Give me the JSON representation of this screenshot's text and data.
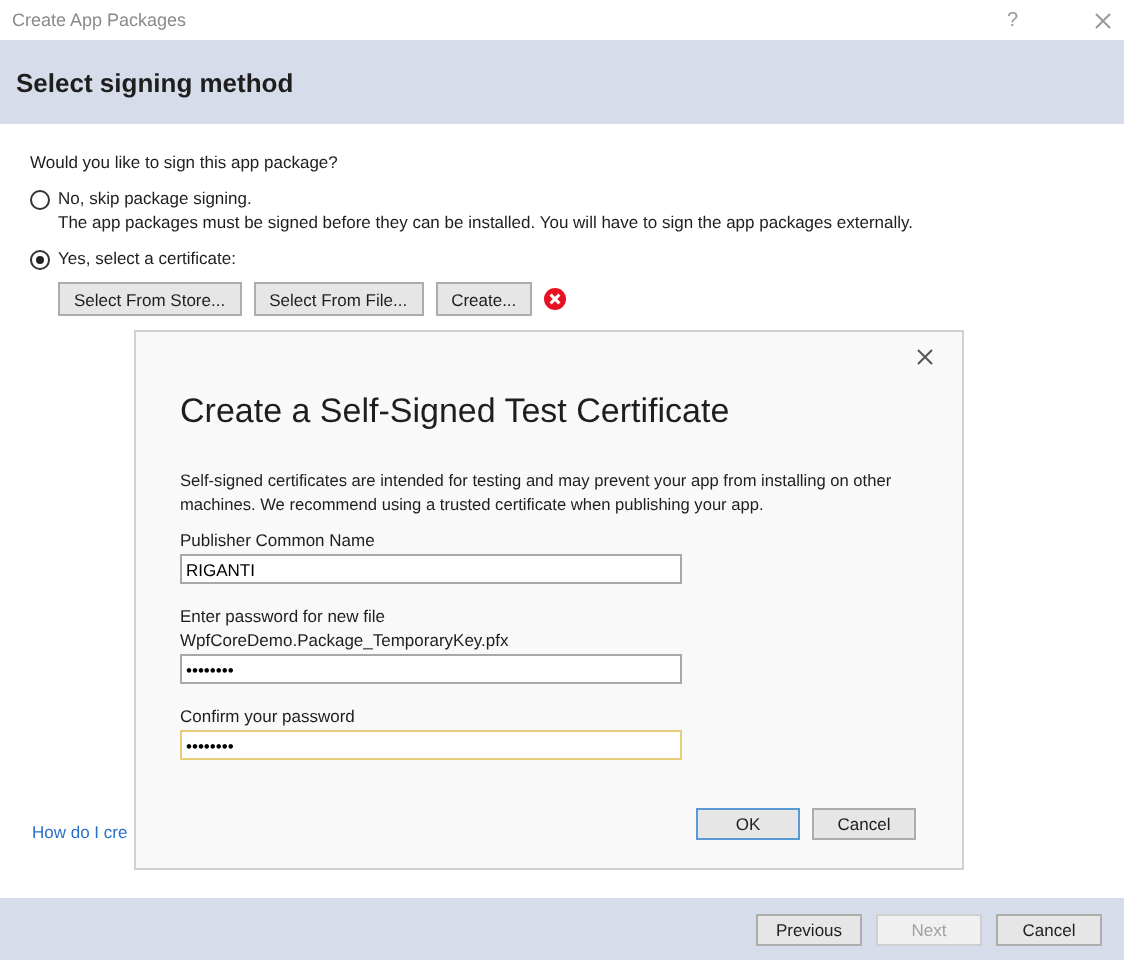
{
  "window": {
    "title": "Create App Packages",
    "help": "?"
  },
  "header": {
    "title": "Select signing method"
  },
  "question": "Would you like to sign this app package?",
  "options": [
    {
      "label": "No, skip package signing.",
      "note": "The app packages must be signed before they can be installed. You will have to sign the app packages externally.",
      "selected": false
    },
    {
      "label": "Yes, select a certificate:",
      "selected": true
    }
  ],
  "certificate_buttons": [
    "Select From Store...",
    "Select From File...",
    "Create..."
  ],
  "status": {
    "kind": "error"
  },
  "help_link": "How do I cre",
  "dialog": {
    "title": "Create a Self-Signed Test Certificate",
    "description": "Self-signed certificates are intended for testing and may prevent your app from installing on other machines. We recommend using a trusted certificate when publishing your app.",
    "fields": [
      {
        "label": "Publisher Common Name",
        "value": "RIGANTI",
        "focused": false
      },
      {
        "label": "Enter password for new file WpfCoreDemo.Package_TemporaryKey.pfx",
        "value": "••••••••",
        "focused": false
      },
      {
        "label": "Confirm your password",
        "value": "••••••••",
        "focused": true
      }
    ],
    "buttons": [
      {
        "label": "OK",
        "default": true
      },
      {
        "label": "Cancel",
        "default": false
      }
    ]
  },
  "footer_buttons": [
    {
      "label": "Previous",
      "disabled": false
    },
    {
      "label": "Next",
      "disabled": true
    },
    {
      "label": "Cancel",
      "disabled": false
    }
  ]
}
